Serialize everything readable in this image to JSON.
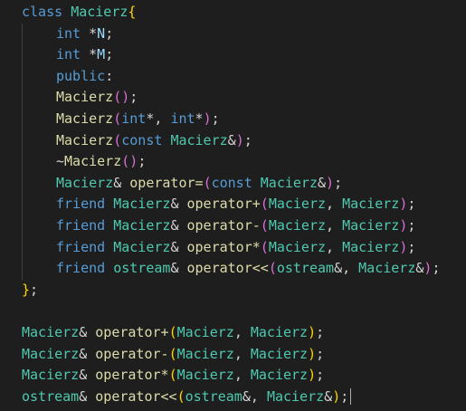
{
  "editor": {
    "theme": {
      "background": "#1e1e1e",
      "keyword": "#569cd6",
      "type": "#4ec9b0",
      "function": "#dcdcaa",
      "variable": "#9cdcfe",
      "bracket1": "#ffd700",
      "bracket2": "#da70d6",
      "text": "#d4d4d4"
    },
    "lines": [
      {
        "t": [
          [
            "kw",
            "class"
          ],
          [
            "op",
            " "
          ],
          [
            "ty",
            "Macierz"
          ],
          [
            "p1",
            "{"
          ]
        ]
      },
      {
        "i": 1,
        "t": [
          [
            "kw",
            "int"
          ],
          [
            "op",
            " *"
          ],
          [
            "va",
            "N"
          ],
          [
            "op",
            ";"
          ]
        ]
      },
      {
        "i": 1,
        "t": [
          [
            "kw",
            "int"
          ],
          [
            "op",
            " *"
          ],
          [
            "va",
            "M"
          ],
          [
            "op",
            ";"
          ]
        ]
      },
      {
        "i": 1,
        "t": [
          [
            "kw",
            "public"
          ],
          [
            "op",
            ":"
          ]
        ]
      },
      {
        "i": 1,
        "t": [
          [
            "fn",
            "Macierz"
          ],
          [
            "p2",
            "()"
          ],
          [
            "op",
            ";"
          ]
        ]
      },
      {
        "i": 1,
        "t": [
          [
            "fn",
            "Macierz"
          ],
          [
            "p2",
            "("
          ],
          [
            "kw",
            "int"
          ],
          [
            "op",
            "*, "
          ],
          [
            "kw",
            "int"
          ],
          [
            "op",
            "*"
          ],
          [
            "p2",
            ")"
          ],
          [
            "op",
            ";"
          ]
        ]
      },
      {
        "i": 1,
        "t": [
          [
            "fn",
            "Macierz"
          ],
          [
            "p2",
            "("
          ],
          [
            "kw",
            "const"
          ],
          [
            "op",
            " "
          ],
          [
            "ty",
            "Macierz"
          ],
          [
            "op",
            "&"
          ],
          [
            "p2",
            ")"
          ],
          [
            "op",
            ";"
          ]
        ]
      },
      {
        "i": 1,
        "t": [
          [
            "op",
            "~"
          ],
          [
            "fn",
            "Macierz"
          ],
          [
            "p2",
            "()"
          ],
          [
            "op",
            ";"
          ]
        ]
      },
      {
        "i": 1,
        "t": [
          [
            "ty",
            "Macierz"
          ],
          [
            "op",
            "& "
          ],
          [
            "fn",
            "operator="
          ],
          [
            "p2",
            "("
          ],
          [
            "kw",
            "const"
          ],
          [
            "op",
            " "
          ],
          [
            "ty",
            "Macierz"
          ],
          [
            "op",
            "&"
          ],
          [
            "p2",
            ")"
          ],
          [
            "op",
            ";"
          ]
        ]
      },
      {
        "i": 1,
        "t": [
          [
            "kw",
            "friend"
          ],
          [
            "op",
            " "
          ],
          [
            "ty",
            "Macierz"
          ],
          [
            "op",
            "& "
          ],
          [
            "fn",
            "operator+"
          ],
          [
            "p2",
            "("
          ],
          [
            "ty",
            "Macierz"
          ],
          [
            "op",
            ", "
          ],
          [
            "ty",
            "Macierz"
          ],
          [
            "p2",
            ")"
          ],
          [
            "op",
            ";"
          ]
        ]
      },
      {
        "i": 1,
        "t": [
          [
            "kw",
            "friend"
          ],
          [
            "op",
            " "
          ],
          [
            "ty",
            "Macierz"
          ],
          [
            "op",
            "& "
          ],
          [
            "fn",
            "operator-"
          ],
          [
            "p2",
            "("
          ],
          [
            "ty",
            "Macierz"
          ],
          [
            "op",
            ", "
          ],
          [
            "ty",
            "Macierz"
          ],
          [
            "p2",
            ")"
          ],
          [
            "op",
            ";"
          ]
        ]
      },
      {
        "i": 1,
        "t": [
          [
            "kw",
            "friend"
          ],
          [
            "op",
            " "
          ],
          [
            "ty",
            "Macierz"
          ],
          [
            "op",
            "& "
          ],
          [
            "fn",
            "operator*"
          ],
          [
            "p2",
            "("
          ],
          [
            "ty",
            "Macierz"
          ],
          [
            "op",
            ", "
          ],
          [
            "ty",
            "Macierz"
          ],
          [
            "p2",
            ")"
          ],
          [
            "op",
            ";"
          ]
        ]
      },
      {
        "i": 1,
        "t": [
          [
            "kw",
            "friend"
          ],
          [
            "op",
            " "
          ],
          [
            "ty",
            "ostream"
          ],
          [
            "op",
            "& "
          ],
          [
            "fn",
            "operator<<"
          ],
          [
            "p2",
            "("
          ],
          [
            "ty",
            "ostream"
          ],
          [
            "op",
            "&, "
          ],
          [
            "ty",
            "Macierz"
          ],
          [
            "op",
            "&"
          ],
          [
            "p2",
            ")"
          ],
          [
            "op",
            ";"
          ]
        ]
      },
      {
        "t": [
          [
            "p1",
            "}"
          ],
          [
            "op",
            ";"
          ]
        ]
      },
      {
        "t": []
      },
      {
        "t": [
          [
            "ty",
            "Macierz"
          ],
          [
            "op",
            "& "
          ],
          [
            "fn",
            "operator+"
          ],
          [
            "p1",
            "("
          ],
          [
            "ty",
            "Macierz"
          ],
          [
            "op",
            ", "
          ],
          [
            "ty",
            "Macierz"
          ],
          [
            "p1",
            ")"
          ],
          [
            "op",
            ";"
          ]
        ]
      },
      {
        "t": [
          [
            "ty",
            "Macierz"
          ],
          [
            "op",
            "& "
          ],
          [
            "fn",
            "operator-"
          ],
          [
            "p1",
            "("
          ],
          [
            "ty",
            "Macierz"
          ],
          [
            "op",
            ", "
          ],
          [
            "ty",
            "Macierz"
          ],
          [
            "p1",
            ")"
          ],
          [
            "op",
            ";"
          ]
        ]
      },
      {
        "t": [
          [
            "ty",
            "Macierz"
          ],
          [
            "op",
            "& "
          ],
          [
            "fn",
            "operator*"
          ],
          [
            "p1",
            "("
          ],
          [
            "ty",
            "Macierz"
          ],
          [
            "op",
            ", "
          ],
          [
            "ty",
            "Macierz"
          ],
          [
            "p1",
            ")"
          ],
          [
            "op",
            ";"
          ]
        ]
      },
      {
        "t": [
          [
            "ty",
            "ostream"
          ],
          [
            "op",
            "& "
          ],
          [
            "fn",
            "operator<<"
          ],
          [
            "p1",
            "("
          ],
          [
            "ty",
            "ostream"
          ],
          [
            "op",
            "&, "
          ],
          [
            "ty",
            "Macierz"
          ],
          [
            "op",
            "&"
          ],
          [
            "p1",
            ")"
          ],
          [
            "op",
            ";"
          ]
        ],
        "cursor": true
      }
    ]
  }
}
